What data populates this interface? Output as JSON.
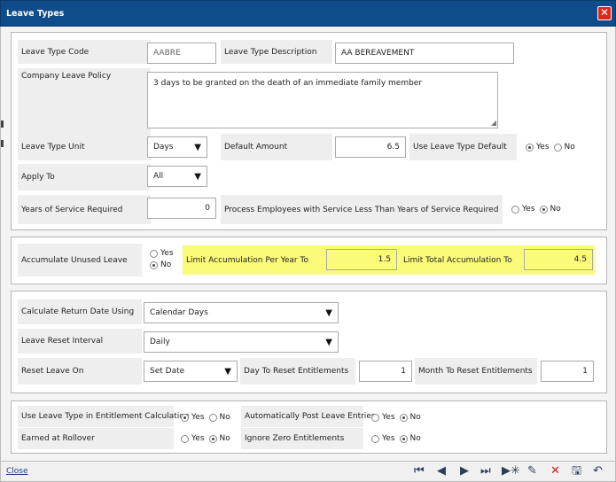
{
  "window": {
    "title": "Leave Types",
    "close_glyph": "✕"
  },
  "general": {
    "code_label": "Leave Type Code",
    "code_value": "AABRE",
    "desc_label": "Leave Type Description",
    "desc_value": "AA BEREAVEMENT",
    "policy_label": "Company Leave Policy",
    "policy_value": "3 days to be granted on the death of an immediate family member",
    "unit_label": "Leave Type Unit",
    "unit_value": "Days",
    "default_amount_label": "Default Amount",
    "default_amount_value": "6.5",
    "use_default_label": "Use Leave Type Default",
    "use_default_selected": "Yes",
    "apply_to_label": "Apply To",
    "apply_to_value": "All",
    "years_label": "Years of Service Required",
    "years_value": "0",
    "process_label": "Process Employees with Service Less Than Years of Service Required",
    "process_selected": "No"
  },
  "accumulation": {
    "accumulate_label": "Accumulate Unused Leave",
    "accumulate_selected": "No",
    "limit_year_label": "Limit Accumulation Per Year To",
    "limit_year_value": "1.5",
    "limit_total_label": "Limit Total Accumulation To",
    "limit_total_value": "4.5"
  },
  "reset": {
    "return_label": "Calculate Return Date Using",
    "return_value": "Calendar Days",
    "interval_label": "Leave Reset Interval",
    "interval_value": "Daily",
    "reset_on_label": "Reset Leave On",
    "reset_on_value": "Set Date",
    "day_label": "Day To Reset Entitlements",
    "day_value": "1",
    "month_label": "Month To Reset Entitlements",
    "month_value": "1"
  },
  "entitlement": {
    "use_in_calc_label": "Use Leave Type in Entitlement Calculation",
    "use_in_calc_selected": "Yes",
    "auto_post_label": "Automatically Post Leave Entries",
    "auto_post_selected": "No",
    "earned_label": "Earned at Rollover",
    "earned_selected": "No",
    "ignore_zero_label": "Ignore Zero Entitlements",
    "ignore_zero_selected": "No"
  },
  "radio_options": {
    "yes": "Yes",
    "no": "No"
  },
  "footer": {
    "close_label": "Close",
    "icons": [
      "first-record-icon",
      "previous-record-icon",
      "next-record-icon",
      "last-record-icon",
      "new-record-icon",
      "edit-icon",
      "delete-icon",
      "save-icon",
      "undo-icon"
    ]
  },
  "colors": {
    "title_bar": "#0f4c8a",
    "highlight": "#fbfb7a",
    "delete": "#d21b1b"
  }
}
